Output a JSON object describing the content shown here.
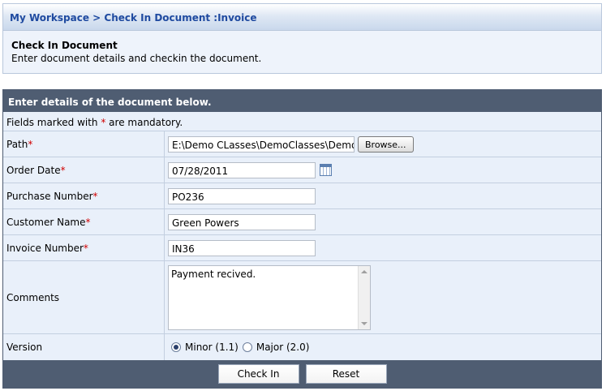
{
  "breadcrumb": "My Workspace > Check In Document :Invoice",
  "header": {
    "title": "Check In Document",
    "description": "Enter document details and checkin the document."
  },
  "panel": {
    "heading": "Enter details of the document below.",
    "note_prefix": "Fields marked with ",
    "note_star": "*",
    "note_suffix": " are mandatory."
  },
  "fields": {
    "path": {
      "label": "Path ",
      "star": "*",
      "value": "E:\\Demo CLasses\\DemoClasses\\DemoC",
      "browse_label": "Browse..."
    },
    "order_date": {
      "label": "Order Date",
      "star": "*",
      "value": "07/28/2011"
    },
    "purchase_number": {
      "label": "Purchase Number",
      "star": "*",
      "value": "PO236"
    },
    "customer_name": {
      "label": "Customer Name",
      "star": "*",
      "value": "Green Powers"
    },
    "invoice_number": {
      "label": "Invoice Number",
      "star": "*",
      "value": "IN36"
    },
    "comments": {
      "label": "Comments",
      "value": "Payment recived."
    },
    "version": {
      "label": "Version",
      "minor": "Minor (1.1)",
      "major": "Major (2.0)",
      "selected": "minor"
    }
  },
  "buttons": {
    "check_in": "Check In",
    "reset": "Reset"
  },
  "colors": {
    "panel_header": "#4f5d72",
    "breadcrumb_text": "#1f4aa0",
    "row_bg": "#e9f0fa",
    "mandatory": "#d00000"
  }
}
